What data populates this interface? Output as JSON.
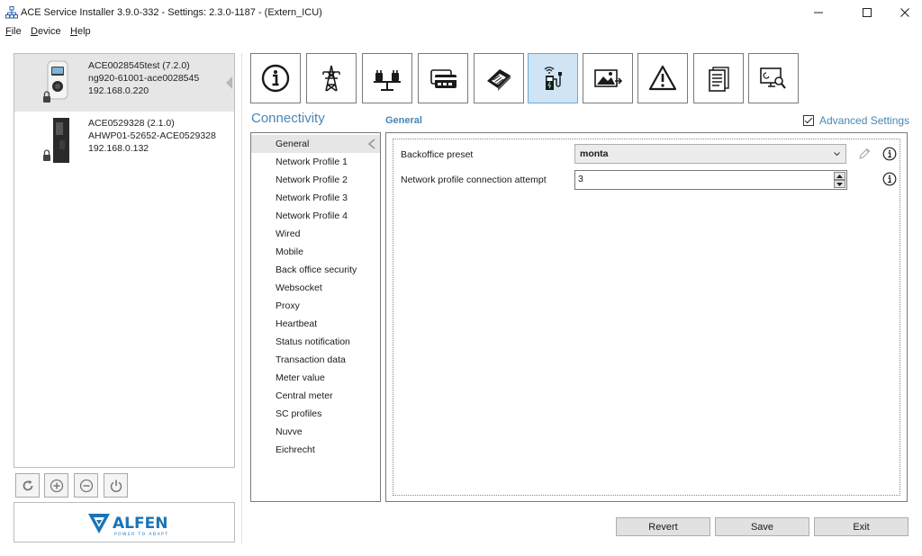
{
  "window": {
    "title": "ACE Service Installer 3.9.0-332 - Settings: 2.3.0-1187 -  (Extern_ICU)"
  },
  "menu": [
    {
      "label": "File"
    },
    {
      "label": "Device"
    },
    {
      "label": "Help"
    }
  ],
  "devices": [
    {
      "line1": "ACE0028545test (7.2.0)",
      "line2": "ng920-61001-ace0028545",
      "line3": "192.168.0.220",
      "selected": true
    },
    {
      "line1": "ACE0529328 (2.1.0)",
      "line2": "AHWP01-52652-ACE0529328",
      "line3": "192.168.0.132",
      "selected": false
    }
  ],
  "device_actions": [
    "refresh-icon",
    "add-icon",
    "remove-icon",
    "power-icon"
  ],
  "logo": {
    "brand": "ALFEN",
    "tagline": "POWER TO ADAPT"
  },
  "toolbar": [
    {
      "name": "info",
      "icon": "info-icon"
    },
    {
      "name": "grid",
      "icon": "power-pylon-icon"
    },
    {
      "name": "balance",
      "icon": "load-balancing-icon"
    },
    {
      "name": "cards",
      "icon": "rfid-card-icon"
    },
    {
      "name": "payment",
      "icon": "payment-terminal-icon"
    },
    {
      "name": "connectivity",
      "icon": "charger-wireless-icon",
      "active": true
    },
    {
      "name": "display",
      "icon": "display-image-icon"
    },
    {
      "name": "warnings",
      "icon": "warning-icon"
    },
    {
      "name": "logs",
      "icon": "document-icon"
    },
    {
      "name": "diagnostics",
      "icon": "monitor-search-icon"
    }
  ],
  "section": {
    "title": "Connectivity",
    "subtitle": "General"
  },
  "advanced_settings": {
    "label": "Advanced Settings",
    "checked": true
  },
  "categories": [
    "General",
    "Network Profile 1",
    "Network Profile 2",
    "Network Profile 3",
    "Network Profile 4",
    "Wired",
    "Mobile",
    "Back office security",
    "Websocket",
    "Proxy",
    "Heartbeat",
    "Status notification",
    "Transaction data",
    "Meter value",
    "Central meter",
    "SC profiles",
    "Nuvve",
    "Eichrecht"
  ],
  "selected_category": "General",
  "fields": {
    "backoffice_preset": {
      "label": "Backoffice preset",
      "value": "monta"
    },
    "connection_attempt": {
      "label": "Network profile connection attempt",
      "value": "3"
    }
  },
  "buttons": {
    "revert": "Revert",
    "save": "Save",
    "exit": "Exit"
  },
  "colors": {
    "accent": "#4a86b3",
    "active_tool": "#cfe4f5",
    "selection": "#e6e6e6",
    "logo_blue": "#1a74b7"
  }
}
